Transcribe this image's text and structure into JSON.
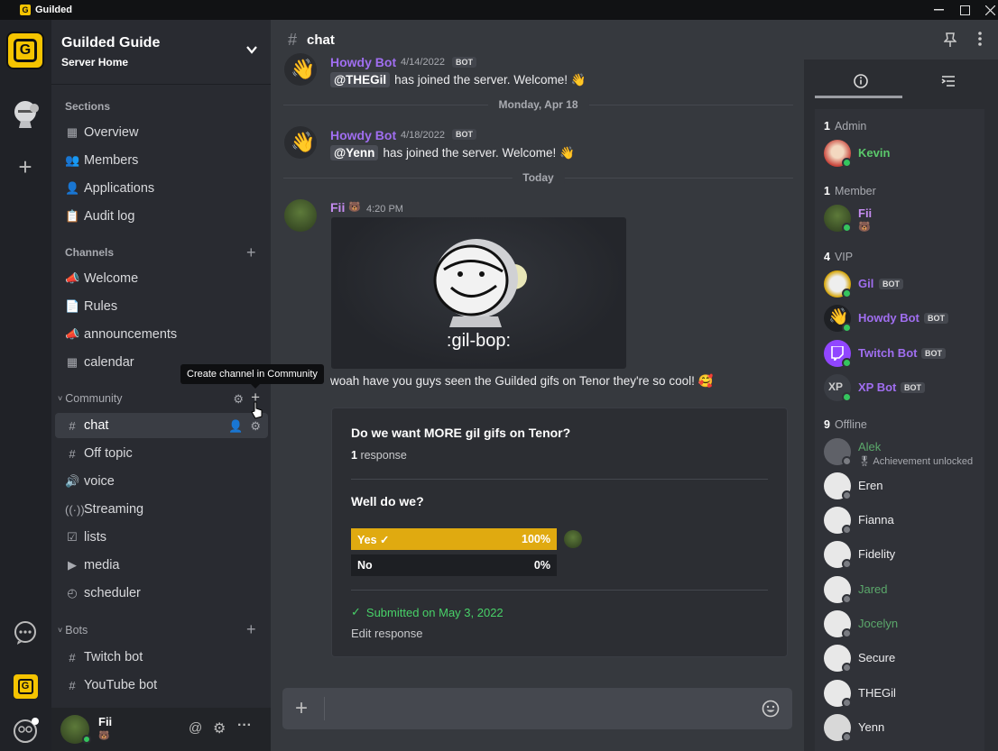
{
  "window": {
    "title": "Guilded"
  },
  "server": {
    "name": "Guilded Guide",
    "subtitle": "Server Home"
  },
  "sections": {
    "title": "Sections",
    "items": [
      {
        "label": "Overview",
        "icon": "overview-icon"
      },
      {
        "label": "Members",
        "icon": "members-icon"
      },
      {
        "label": "Applications",
        "icon": "applications-icon"
      },
      {
        "label": "Audit log",
        "icon": "audit-log-icon"
      }
    ]
  },
  "channels": {
    "title": "Channels",
    "items": [
      {
        "label": "Welcome",
        "icon": "announcement-icon"
      },
      {
        "label": "Rules",
        "icon": "document-icon"
      },
      {
        "label": "announcements",
        "icon": "announcement-icon"
      },
      {
        "label": "calendar",
        "icon": "calendar-icon"
      }
    ]
  },
  "community": {
    "title": "Community",
    "items": [
      {
        "label": "chat",
        "icon": "hash-icon",
        "active": true
      },
      {
        "label": "Off topic",
        "icon": "hash-icon"
      },
      {
        "label": "voice",
        "icon": "voice-icon"
      },
      {
        "label": "Streaming",
        "icon": "stream-icon"
      },
      {
        "label": "lists",
        "icon": "checklist-icon"
      },
      {
        "label": "media",
        "icon": "media-icon"
      },
      {
        "label": "scheduler",
        "icon": "clock-icon"
      }
    ]
  },
  "bots": {
    "title": "Bots",
    "items": [
      {
        "label": "Twitch bot",
        "icon": "hash-icon"
      },
      {
        "label": "YouTube bot",
        "icon": "hash-icon"
      }
    ]
  },
  "tooltip": {
    "text": "Create channel in Community"
  },
  "user": {
    "name": "Fii",
    "emoji": "🐻"
  },
  "chat": {
    "channel": "chat",
    "messages": [
      {
        "author": "Howdy Bot",
        "time": "4/14/2022",
        "tag": "BOT",
        "mention": "@THEGil",
        "text": "has joined the server. Welcome! 👋"
      },
      {
        "divider": "Monday, Apr 18"
      },
      {
        "author": "Howdy Bot",
        "time": "4/18/2022",
        "tag": "BOT",
        "mention": "@Yenn",
        "text": "has joined the server. Welcome! 👋"
      },
      {
        "divider": "Today"
      },
      {
        "author": "Fii",
        "emoji": "🐻",
        "time": "4:20 PM",
        "gif_caption": ":gil-bop:",
        "text": "woah have you guys seen the Guilded gifs on Tenor they're so cool! 🥰"
      }
    ],
    "poll": {
      "title": "Do we want MORE gil gifs on Tenor?",
      "response_count": "1",
      "response_label": "response",
      "question": "Well do we?",
      "options": [
        {
          "label": "Yes",
          "pct": "100%",
          "value": 100
        },
        {
          "label": "No",
          "pct": "0%",
          "value": 0
        }
      ],
      "submitted": "Submitted on May 3, 2022",
      "edit": "Edit response"
    }
  },
  "members": {
    "groups": [
      {
        "count": "1",
        "name": "Admin"
      },
      {
        "count": "1",
        "name": "Member"
      },
      {
        "count": "4",
        "name": "VIP"
      },
      {
        "count": "9",
        "name": "Offline"
      }
    ],
    "list": [
      {
        "name": "Kevin",
        "color": "#5bc96b",
        "status": "online"
      },
      {
        "name": "Fii",
        "sub": "🐻",
        "color": "#b77ad9",
        "status": "online"
      },
      {
        "name": "Gil",
        "tag": "BOT",
        "color": "#b77ad9",
        "status": "online"
      },
      {
        "name": "Howdy Bot",
        "tag": "BOT",
        "color": "#b77ad9",
        "status": "online"
      },
      {
        "name": "Twitch Bot",
        "tag": "BOT",
        "color": "#b77ad9",
        "status": "online"
      },
      {
        "name": "XP Bot",
        "tag": "BOT",
        "color": "#b77ad9",
        "status": "online"
      },
      {
        "name": "Alek",
        "sub": "🎖 Achievement unlocked",
        "color": "#5ba86b",
        "status": "offline"
      },
      {
        "name": "Eren",
        "color": "#ececee",
        "status": "offline"
      },
      {
        "name": "Fianna",
        "color": "#ececee",
        "status": "offline"
      },
      {
        "name": "Fidelity",
        "color": "#ececee",
        "status": "offline"
      },
      {
        "name": "Jared",
        "color": "#5ba86b",
        "status": "offline"
      },
      {
        "name": "Jocelyn",
        "color": "#5ba86b",
        "status": "offline"
      },
      {
        "name": "Secure",
        "color": "#ececee",
        "status": "offline"
      },
      {
        "name": "THEGil",
        "color": "#ececee",
        "status": "offline"
      },
      {
        "name": "Yenn",
        "color": "#ececee",
        "status": "offline"
      }
    ]
  },
  "colors": {
    "accent": "#f5c400",
    "bot_name": "#a06ef0",
    "online": "#35c55e"
  }
}
